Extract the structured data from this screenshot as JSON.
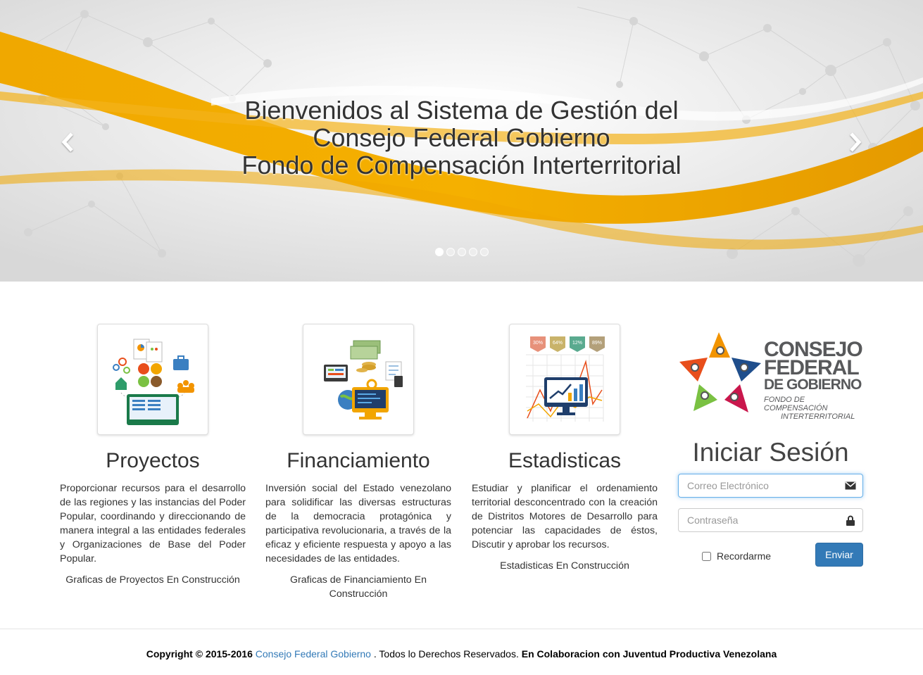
{
  "carousel": {
    "caption_line1": "Bienvenidos al Sistema de Gestión del",
    "caption_line2": "Consejo Federal Gobierno",
    "caption_line3": "Fondo de Compensación Interterritorial",
    "prev_icon": "chevron-left-icon",
    "next_icon": "chevron-right-icon",
    "slide_count": 5,
    "active_slide": 1
  },
  "features": [
    {
      "title": "Proyectos",
      "description": "Proporcionar recursos para el desarrollo de las regiones y las instancias del Poder Popular, coordinando y direccionando de manera integral a las entidades federales y Organizaciones de Base del Poder Popular.",
      "note": "Graficas de Proyectos En Construcción"
    },
    {
      "title": "Financiamiento",
      "description": "Inversión social del Estado venezolano para solidificar las diversas estructuras de la democracia protagónica y participativa revolucionaria, a través de la eficaz y eficiente respuesta y apoyo a las necesidades de las entidades.",
      "note": "Graficas de Financiamiento En Construcción"
    },
    {
      "title": "Estadisticas",
      "description": "Estudiar y planificar el ordenamiento territorial desconcentrado con la creación de Distritos Motores de Desarrollo para potenciar las capacidades de éstos, Discutir y aprobar los recursos.",
      "note": "Estadisticas En Construcción",
      "thumb_badges": [
        "30%",
        "64%",
        "12%",
        "89%"
      ]
    }
  ],
  "logo": {
    "line1": "CONSEJO",
    "line2": "FEDERAL",
    "line3": "DE GOBIERNO",
    "line4": "FONDO DE COMPENSACIÓN",
    "line5": "INTERTERRITORIAL"
  },
  "login": {
    "title": "Iniciar Sesión",
    "email_placeholder": "Correo Electrónico",
    "password_placeholder": "Contraseña",
    "remember_label": "Recordarme",
    "submit_label": "Enviar"
  },
  "footer": {
    "copyright": "Copyright © 2015-2016",
    "org_link": "Consejo Federal Gobierno",
    "rights": ". Todos lo Derechos Reservados.",
    "collab": "En Colaboracion con Juventud Productiva Venezolana"
  },
  "colors": {
    "accent_orange": "#f2a500",
    "primary_blue": "#337ab7",
    "logo_gray": "#58595b"
  }
}
